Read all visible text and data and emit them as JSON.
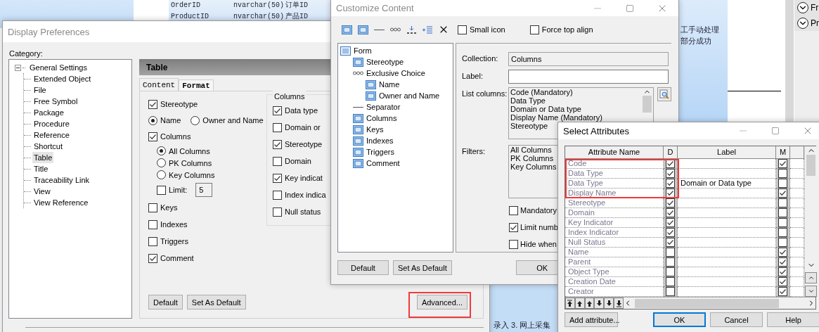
{
  "background": {
    "table_rows": [
      {
        "name": "OrderID",
        "type": "nvarchar(50)",
        "comment": "订单ID"
      },
      {
        "name": "ProductID",
        "type": "nvarchar(50)",
        "comment": "产品ID"
      }
    ],
    "note_lines": [
      "工手动处理",
      "部分成功"
    ],
    "footer_note": "录入 3. 网上采集",
    "side_items": [
      {
        "label": "Fr"
      },
      {
        "label": "Pr"
      }
    ]
  },
  "display_preferences": {
    "title": "Display Preferences",
    "category_label": "Category:",
    "tree": [
      {
        "label": "General Settings",
        "expanded": true,
        "selected": false,
        "children": [
          {
            "label": "Extended Object",
            "selected": false
          },
          {
            "label": "File",
            "selected": false
          },
          {
            "label": "Free Symbol",
            "selected": false
          },
          {
            "label": "Package",
            "selected": false
          },
          {
            "label": "Procedure",
            "selected": false
          },
          {
            "label": "Reference",
            "selected": false
          },
          {
            "label": "Shortcut",
            "selected": false
          },
          {
            "label": "Table",
            "selected": true
          },
          {
            "label": "Title",
            "selected": false
          },
          {
            "label": "Traceability Link",
            "selected": false
          },
          {
            "label": "View",
            "selected": false
          },
          {
            "label": "View Reference",
            "selected": false
          }
        ]
      }
    ],
    "panel_title": "Table",
    "tabs": [
      {
        "label": "Content",
        "selected": true
      },
      {
        "label": "Format",
        "selected": false
      }
    ],
    "options": [
      {
        "kind": "checkbox",
        "label": "Stereotype",
        "checked": true
      },
      {
        "kind": "radio_row",
        "choices": [
          {
            "label": "Name",
            "selected": true
          },
          {
            "label": "Owner and Name",
            "selected": false
          }
        ]
      },
      {
        "kind": "checkbox",
        "label": "Columns",
        "checked": true
      },
      {
        "kind": "radio",
        "label": "All Columns",
        "selected": true
      },
      {
        "kind": "radio",
        "label": "PK Columns",
        "selected": false
      },
      {
        "kind": "radio",
        "label": "Key Columns",
        "selected": false
      },
      {
        "kind": "limit",
        "label": "Limit:",
        "checked": false,
        "value": "5"
      },
      {
        "kind": "checkbox",
        "label": "Keys",
        "checked": false
      },
      {
        "kind": "checkbox",
        "label": "Indexes",
        "checked": false
      },
      {
        "kind": "checkbox",
        "label": "Triggers",
        "checked": false
      },
      {
        "kind": "checkbox",
        "label": "Comment",
        "checked": true
      }
    ],
    "columns_group": {
      "title": "Columns",
      "options": [
        {
          "label": "Data type",
          "checked": true
        },
        {
          "label": "Domain or",
          "checked": false
        },
        {
          "label": "Stereotype",
          "checked": true
        },
        {
          "label": "Domain",
          "checked": false
        },
        {
          "label": "Key indicat",
          "checked": true
        },
        {
          "label": "Index indica",
          "checked": false
        },
        {
          "label": "Null status",
          "checked": false
        }
      ]
    },
    "buttons": [
      "Default",
      "Set As Default"
    ],
    "advanced_button": {
      "label": "Advanced...",
      "highlighted": true
    }
  },
  "customize_content": {
    "title": "Customize Content",
    "toolbar_checks": [
      {
        "label": "Small icon",
        "checked": false
      },
      {
        "label": "Force top align",
        "checked": false
      }
    ],
    "tree": [
      {
        "label": "Form",
        "kind": "form",
        "children": [
          {
            "label": "Stereotype",
            "kind": "attribute"
          },
          {
            "label": "Exclusive Choice",
            "kind": "choice",
            "children": [
              {
                "label": "Name",
                "kind": "attribute"
              },
              {
                "label": "Owner and Name",
                "kind": "attribute"
              }
            ]
          },
          {
            "label": "Separator",
            "kind": "separator"
          },
          {
            "label": "Columns",
            "kind": "attribute"
          },
          {
            "label": "Keys",
            "kind": "attribute"
          },
          {
            "label": "Indexes",
            "kind": "attribute"
          },
          {
            "label": "Triggers",
            "kind": "attribute"
          },
          {
            "label": "Comment",
            "kind": "attribute"
          }
        ]
      }
    ],
    "collection_label": "Collection:",
    "collection_value": "Columns",
    "label_label": "Label:",
    "list_columns_label": "List columns:",
    "list_columns": [
      "Code (Mandatory)",
      "Data Type",
      "Domain or Data type",
      "Display Name (Mandatory)",
      "Stereotype"
    ],
    "filters_label": "Filters:",
    "filters": [
      "All Columns",
      "PK Columns",
      "Key Columns"
    ],
    "options": [
      {
        "label": "Mandatory",
        "checked": false
      },
      {
        "label": "Limit numb",
        "checked": true
      },
      {
        "label": "Hide when",
        "checked": false
      }
    ],
    "buttons": [
      "Default",
      "Set As Default"
    ],
    "ok_button": "OK"
  },
  "select_attributes": {
    "title": "Select Attributes",
    "columns": [
      "Attribute Name",
      "D",
      "Label",
      "M"
    ],
    "rows": [
      {
        "name": "Code",
        "d": true,
        "label": "",
        "m": true,
        "highlighted": true
      },
      {
        "name": "Data Type",
        "d": true,
        "label": "",
        "m": false,
        "highlighted": true
      },
      {
        "name": "Data Type",
        "d": true,
        "label": "Domain or Data type",
        "m": false,
        "highlighted": true
      },
      {
        "name": "Display Name",
        "d": true,
        "label": "",
        "m": true,
        "highlighted": true
      },
      {
        "name": "Stereotype",
        "d": true,
        "label": "",
        "m": false,
        "highlighted": false
      },
      {
        "name": "Domain",
        "d": true,
        "label": "",
        "m": false,
        "highlighted": false
      },
      {
        "name": "Key Indicator",
        "d": true,
        "label": "",
        "m": false,
        "highlighted": false
      },
      {
        "name": "Index Indicator",
        "d": true,
        "label": "",
        "m": false,
        "highlighted": false
      },
      {
        "name": "Null Status",
        "d": true,
        "label": "",
        "m": false,
        "highlighted": false
      },
      {
        "name": "Name",
        "d": false,
        "label": "",
        "m": true,
        "highlighted": false
      },
      {
        "name": "Parent",
        "d": false,
        "label": "",
        "m": true,
        "highlighted": false
      },
      {
        "name": "Object Type",
        "d": false,
        "label": "",
        "m": true,
        "highlighted": false
      },
      {
        "name": "Creation Date",
        "d": false,
        "label": "",
        "m": true,
        "highlighted": false
      },
      {
        "name": "Creator",
        "d": false,
        "label": "",
        "m": true,
        "highlighted": false
      }
    ],
    "buttons": [
      {
        "label": "Add attribute...",
        "default": false
      },
      {
        "label": "OK",
        "default": true
      },
      {
        "label": "Cancel",
        "default": false
      },
      {
        "label": "Help",
        "default": false
      }
    ]
  }
}
